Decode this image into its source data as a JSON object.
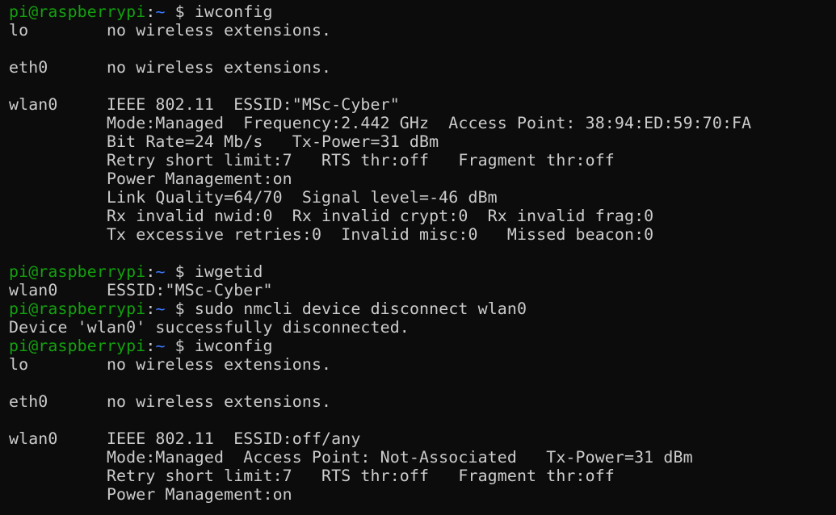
{
  "theme": {
    "background": "#0c0c0c",
    "foreground": "#cccccc",
    "prompt_user_color": "#13a10e",
    "prompt_path_color": "#3b78ff"
  },
  "lines": [
    {
      "type": "prompt",
      "user": "pi@raspberrypi",
      "sep": ":",
      "path": "~",
      "dollar": " $ ",
      "cmd": "iwconfig"
    },
    {
      "type": "output",
      "text": "lo        no wireless extensions."
    },
    {
      "type": "blank",
      "text": ""
    },
    {
      "type": "output",
      "text": "eth0      no wireless extensions."
    },
    {
      "type": "blank",
      "text": ""
    },
    {
      "type": "output",
      "text": "wlan0     IEEE 802.11  ESSID:\"MSc-Cyber\""
    },
    {
      "type": "output",
      "text": "          Mode:Managed  Frequency:2.442 GHz  Access Point: 38:94:ED:59:70:FA"
    },
    {
      "type": "output",
      "text": "          Bit Rate=24 Mb/s   Tx-Power=31 dBm"
    },
    {
      "type": "output",
      "text": "          Retry short limit:7   RTS thr:off   Fragment thr:off"
    },
    {
      "type": "output",
      "text": "          Power Management:on"
    },
    {
      "type": "output",
      "text": "          Link Quality=64/70  Signal level=-46 dBm"
    },
    {
      "type": "output",
      "text": "          Rx invalid nwid:0  Rx invalid crypt:0  Rx invalid frag:0"
    },
    {
      "type": "output",
      "text": "          Tx excessive retries:0  Invalid misc:0   Missed beacon:0"
    },
    {
      "type": "blank",
      "text": ""
    },
    {
      "type": "prompt",
      "user": "pi@raspberrypi",
      "sep": ":",
      "path": "~",
      "dollar": " $ ",
      "cmd": "iwgetid"
    },
    {
      "type": "output",
      "text": "wlan0     ESSID:\"MSc-Cyber\""
    },
    {
      "type": "prompt",
      "user": "pi@raspberrypi",
      "sep": ":",
      "path": "~",
      "dollar": " $ ",
      "cmd": "sudo nmcli device disconnect wlan0"
    },
    {
      "type": "output",
      "text": "Device 'wlan0' successfully disconnected."
    },
    {
      "type": "prompt",
      "user": "pi@raspberrypi",
      "sep": ":",
      "path": "~",
      "dollar": " $ ",
      "cmd": "iwconfig"
    },
    {
      "type": "output",
      "text": "lo        no wireless extensions."
    },
    {
      "type": "blank",
      "text": ""
    },
    {
      "type": "output",
      "text": "eth0      no wireless extensions."
    },
    {
      "type": "blank",
      "text": ""
    },
    {
      "type": "output",
      "text": "wlan0     IEEE 802.11  ESSID:off/any"
    },
    {
      "type": "output",
      "text": "          Mode:Managed  Access Point: Not-Associated   Tx-Power=31 dBm"
    },
    {
      "type": "output",
      "text": "          Retry short limit:7   RTS thr:off   Fragment thr:off"
    },
    {
      "type": "output",
      "text": "          Power Management:on"
    }
  ]
}
